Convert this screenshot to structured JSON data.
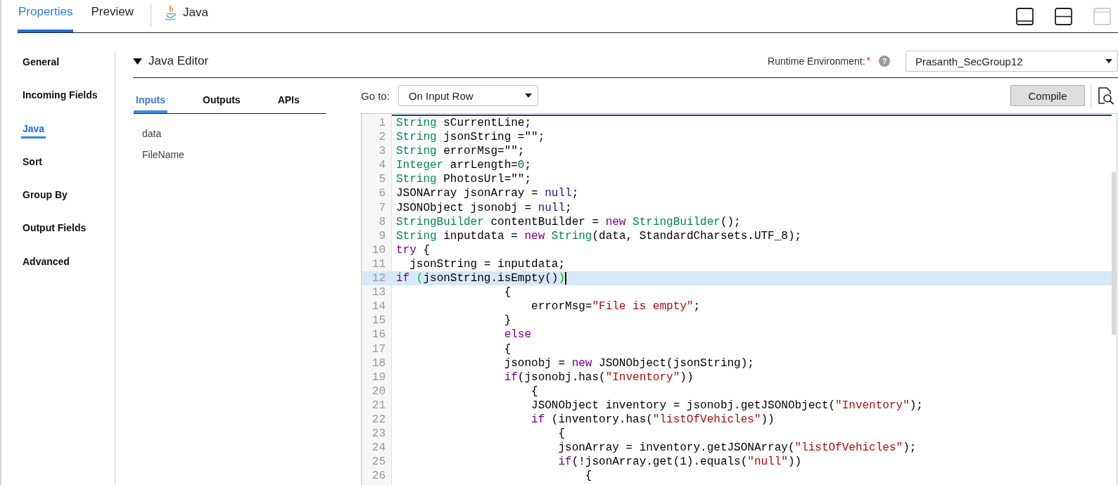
{
  "top_tabs": [
    {
      "label": "Properties",
      "selected": true
    },
    {
      "label": "Preview",
      "selected": false
    }
  ],
  "object_tab": {
    "label": "Java"
  },
  "view_buttons": [
    {
      "kind": "bottom",
      "disabled": false
    },
    {
      "kind": "split",
      "disabled": false
    },
    {
      "kind": "top",
      "disabled": true
    }
  ],
  "sidebar": {
    "items": [
      {
        "label": "General",
        "selected": false
      },
      {
        "label": "Incoming Fields",
        "selected": false
      },
      {
        "label": "Java",
        "selected": true
      },
      {
        "label": "Sort",
        "selected": false
      },
      {
        "label": "Group By",
        "selected": false
      },
      {
        "label": "Output Fields",
        "selected": false
      },
      {
        "label": "Advanced",
        "selected": false
      }
    ]
  },
  "section": {
    "title": "Java Editor",
    "expanded": true
  },
  "runtime_environment": {
    "label": "Runtime Environment:",
    "required_mark": "*",
    "help_icon": "?",
    "value": "Prasanth_SecGroup12"
  },
  "editor_tabs": [
    {
      "label": "Inputs",
      "selected": true
    },
    {
      "label": "Outputs",
      "selected": false
    },
    {
      "label": "APIs",
      "selected": false
    }
  ],
  "input_fields": [
    "data",
    "FileName"
  ],
  "goto": {
    "label": "Go to:",
    "value": "On Input Row"
  },
  "compile_button": {
    "label": "Compile"
  },
  "code": {
    "lines": [
      {
        "number": "1",
        "selected": false,
        "tokens": [
          {
            "kind": "type",
            "text": "String"
          },
          {
            "kind": "plain",
            "text": " sCurrentLine;"
          }
        ]
      },
      {
        "number": "2",
        "selected": false,
        "tokens": [
          {
            "kind": "type",
            "text": "String"
          },
          {
            "kind": "plain",
            "text": " jsonString =\"\";"
          }
        ]
      },
      {
        "number": "3",
        "selected": false,
        "tokens": [
          {
            "kind": "type",
            "text": "String"
          },
          {
            "kind": "plain",
            "text": " errorMsg=\"\";"
          }
        ]
      },
      {
        "number": "4",
        "selected": false,
        "tokens": [
          {
            "kind": "type",
            "text": "Integer"
          },
          {
            "kind": "plain",
            "text": " arrLength="
          },
          {
            "kind": "number",
            "text": "0"
          },
          {
            "kind": "plain",
            "text": ";"
          }
        ]
      },
      {
        "number": "5",
        "selected": false,
        "tokens": [
          {
            "kind": "type",
            "text": "String"
          },
          {
            "kind": "plain",
            "text": " PhotosUrl=\"\";"
          }
        ]
      },
      {
        "number": "6",
        "selected": false,
        "tokens": [
          {
            "kind": "plain",
            "text": "JSONArray jsonArray = "
          },
          {
            "kind": "atom",
            "text": "null"
          },
          {
            "kind": "plain",
            "text": ";"
          }
        ]
      },
      {
        "number": "7",
        "selected": false,
        "tokens": [
          {
            "kind": "plain",
            "text": "JSONObject jsonobj = "
          },
          {
            "kind": "atom",
            "text": "null"
          },
          {
            "kind": "plain",
            "text": ";"
          }
        ]
      },
      {
        "number": "8",
        "selected": false,
        "tokens": [
          {
            "kind": "type",
            "text": "StringBuilder"
          },
          {
            "kind": "plain",
            "text": " contentBuilder = "
          },
          {
            "kind": "keyword",
            "text": "new"
          },
          {
            "kind": "type",
            "text": " StringBuilder"
          },
          {
            "kind": "plain",
            "text": "();"
          }
        ]
      },
      {
        "number": "9",
        "selected": false,
        "tokens": [
          {
            "kind": "type",
            "text": "String"
          },
          {
            "kind": "plain",
            "text": " inputdata = "
          },
          {
            "kind": "keyword",
            "text": "new"
          },
          {
            "kind": "type",
            "text": " String"
          },
          {
            "kind": "plain",
            "text": "(data, StandardCharsets.UTF_8);"
          }
        ]
      },
      {
        "number": "10",
        "selected": false,
        "tokens": [
          {
            "kind": "keyword",
            "text": "try"
          },
          {
            "kind": "plain",
            "text": " {"
          }
        ]
      },
      {
        "number": "11",
        "selected": false,
        "tokens": [
          {
            "kind": "plain",
            "text": "  jsonString = inputdata;"
          }
        ]
      },
      {
        "number": "12",
        "selected": true,
        "tokens": [
          {
            "kind": "keyword",
            "text": "if "
          },
          {
            "kind": "match",
            "text": "("
          },
          {
            "kind": "plain",
            "text": "jsonString.isEmpty()"
          },
          {
            "kind": "match",
            "text": ")"
          }
        ]
      },
      {
        "number": "13",
        "selected": false,
        "tokens": [
          {
            "kind": "plain",
            "text": "                {"
          }
        ]
      },
      {
        "number": "14",
        "selected": false,
        "tokens": [
          {
            "kind": "plain",
            "text": "                    errorMsg="
          },
          {
            "kind": "string",
            "text": "\"File is empty\""
          },
          {
            "kind": "plain",
            "text": ";"
          }
        ]
      },
      {
        "number": "15",
        "selected": false,
        "tokens": [
          {
            "kind": "plain",
            "text": "                }"
          }
        ]
      },
      {
        "number": "16",
        "selected": false,
        "tokens": [
          {
            "kind": "keyword",
            "text": "                else"
          }
        ]
      },
      {
        "number": "17",
        "selected": false,
        "tokens": [
          {
            "kind": "plain",
            "text": "                {"
          }
        ]
      },
      {
        "number": "18",
        "selected": false,
        "tokens": [
          {
            "kind": "plain",
            "text": "                jsonobj = "
          },
          {
            "kind": "keyword",
            "text": "new"
          },
          {
            "kind": "plain",
            "text": " JSONObject(jsonString);"
          }
        ]
      },
      {
        "number": "19",
        "selected": false,
        "tokens": [
          {
            "kind": "keyword",
            "text": "                if"
          },
          {
            "kind": "plain",
            "text": "(jsonobj.has("
          },
          {
            "kind": "string",
            "text": "\"Inventory\""
          },
          {
            "kind": "plain",
            "text": "))"
          }
        ]
      },
      {
        "number": "20",
        "selected": false,
        "tokens": [
          {
            "kind": "plain",
            "text": "                    {"
          }
        ]
      },
      {
        "number": "21",
        "selected": false,
        "tokens": [
          {
            "kind": "plain",
            "text": "                    JSONObject inventory = jsonobj.getJSONObject("
          },
          {
            "kind": "string",
            "text": "\"Inventory\""
          },
          {
            "kind": "plain",
            "text": ");"
          }
        ]
      },
      {
        "number": "22",
        "selected": false,
        "tokens": [
          {
            "kind": "keyword",
            "text": "                    if"
          },
          {
            "kind": "plain",
            "text": " (inventory.has("
          },
          {
            "kind": "string",
            "text": "\"listOfVehicles\""
          },
          {
            "kind": "plain",
            "text": "))"
          }
        ]
      },
      {
        "number": "23",
        "selected": false,
        "tokens": [
          {
            "kind": "plain",
            "text": "                        {"
          }
        ]
      },
      {
        "number": "24",
        "selected": false,
        "tokens": [
          {
            "kind": "plain",
            "text": "                        jsonArray = inventory.getJSONArray("
          },
          {
            "kind": "string",
            "text": "\"listOfVehicles\""
          },
          {
            "kind": "plain",
            "text": ");"
          }
        ]
      },
      {
        "number": "25",
        "selected": false,
        "tokens": [
          {
            "kind": "keyword",
            "text": "                        if"
          },
          {
            "kind": "plain",
            "text": "(!jsonArray.get(1).equals("
          },
          {
            "kind": "string",
            "text": "\"null\""
          },
          {
            "kind": "plain",
            "text": "))"
          }
        ]
      },
      {
        "number": "26",
        "selected": false,
        "tokens": [
          {
            "kind": "plain",
            "text": "                            {"
          }
        ]
      }
    ]
  }
}
